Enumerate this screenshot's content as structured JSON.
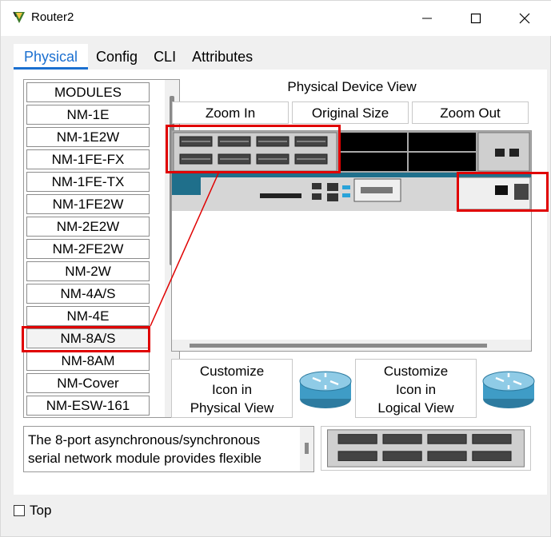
{
  "window": {
    "title": "Router2",
    "accent": "#1a6fd0",
    "highlight": "#e00000"
  },
  "tabs": [
    {
      "label": "Physical",
      "active": true
    },
    {
      "label": "Config",
      "active": false
    },
    {
      "label": "CLI",
      "active": false
    },
    {
      "label": "Attributes",
      "active": false
    }
  ],
  "modules": {
    "header": "MODULES",
    "items": [
      "NM-1E",
      "NM-1E2W",
      "NM-1FE-FX",
      "NM-1FE-TX",
      "NM-1FE2W",
      "NM-2E2W",
      "NM-2FE2W",
      "NM-2W",
      "NM-4A/S",
      "NM-4E",
      "NM-8A/S",
      "NM-8AM",
      "NM-Cover",
      "NM-ESW-161"
    ],
    "selected": "NM-8A/S"
  },
  "device_view": {
    "label": "Physical Device View",
    "zoom_in": "Zoom In",
    "original_size": "Original Size",
    "zoom_out": "Zoom Out"
  },
  "customize": {
    "physical_label": "Customize Icon in Physical View",
    "logical_label": "Customize Icon in Logical View",
    "physical_line1": "Customize",
    "physical_line2": "Icon in",
    "physical_line3": "Physical View",
    "logical_line1": "Customize",
    "logical_line2": "Icon in",
    "logical_line3": "Logical View"
  },
  "description": {
    "text": "The 8-port asynchronous/synchronous serial network module provides flexible"
  },
  "footer": {
    "top_label": "Top",
    "top_checked": false
  }
}
